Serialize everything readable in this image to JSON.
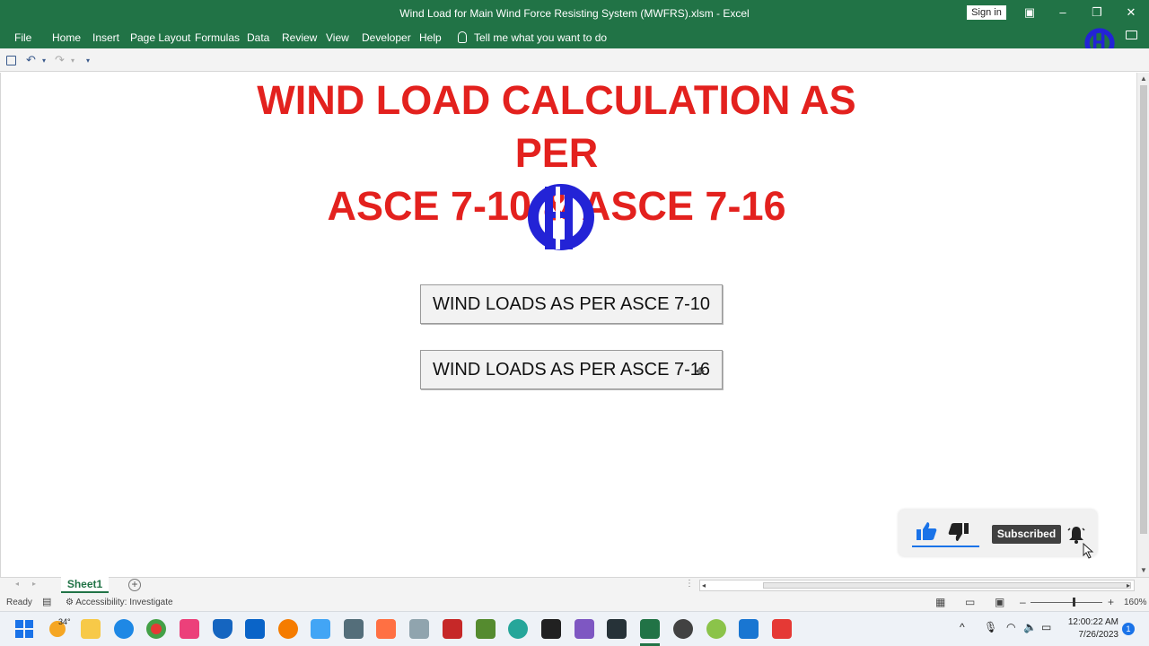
{
  "window": {
    "title": "Wind Load for Main Wind Force Resisting System (MWFRS).xlsm  -  Excel",
    "sign_in": "Sign in"
  },
  "ribbon": {
    "tabs": [
      "File",
      "Home",
      "Insert",
      "Page Layout",
      "Formulas",
      "Data",
      "Review",
      "View",
      "Developer",
      "Help"
    ],
    "tell_me": "Tell me what you want to do"
  },
  "sheet": {
    "title_line1": "WIND LOAD CALCULATION AS PER",
    "title_line2": "ASCE 7-10 & ASCE 7-16",
    "buttons": [
      "WIND LOADS AS PER ASCE 7-10",
      "WIND LOADS AS PER ASCE 7-16"
    ],
    "colors": {
      "title": "#e3211e",
      "logo": "#2323d6"
    }
  },
  "overlay": {
    "subscribed_label": "Subscribed"
  },
  "sheet_tabs": {
    "active": "Sheet1"
  },
  "status": {
    "ready": "Ready",
    "accessibility": "Accessibility: Investigate",
    "zoom": "160%"
  },
  "taskbar": {
    "weather": "34°",
    "time": "12:00:22 AM",
    "date": "7/26/2023",
    "notification_count": "1"
  },
  "colors": {
    "excel_green": "#217346"
  }
}
